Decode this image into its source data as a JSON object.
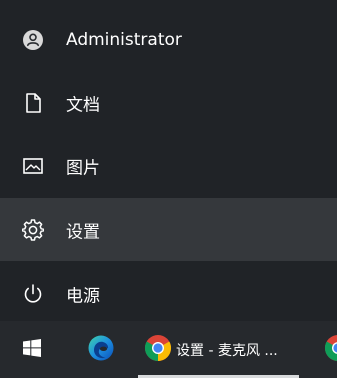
{
  "menu": {
    "items": [
      {
        "label": "Administrator",
        "icon": "user-avatar-icon"
      },
      {
        "label": "文档",
        "icon": "document-icon"
      },
      {
        "label": "图片",
        "icon": "picture-icon"
      },
      {
        "label": "设置",
        "icon": "gear-icon"
      },
      {
        "label": "电源",
        "icon": "power-icon"
      }
    ]
  },
  "taskbar": {
    "start_icon": "windows-logo-icon",
    "apps": [
      {
        "icon": "edge-browser-icon"
      },
      {
        "icon": "chrome-browser-icon",
        "label": "设置 - 麦克风 ..."
      },
      {
        "icon": "chrome-browser-icon"
      }
    ]
  },
  "colors": {
    "menu_bg": "#202327",
    "hover_bg": "#35383c",
    "taskbar_bg": "#26292d",
    "text": "#ffffff"
  }
}
